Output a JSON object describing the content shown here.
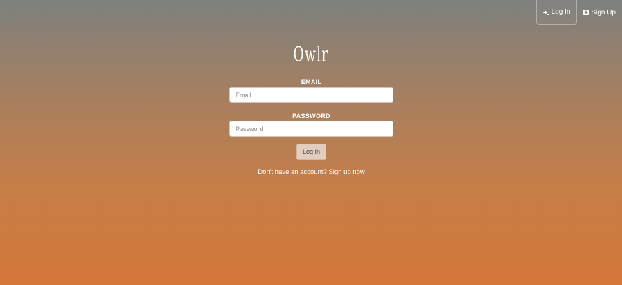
{
  "nav": {
    "login_label": "Log In",
    "signup_label": "Sign Up"
  },
  "logo": "Owlr",
  "form": {
    "email_label": "EMAIL",
    "email_placeholder": "Email",
    "password_label": "PASSWORD",
    "password_placeholder": "Password",
    "submit_label": "Log In",
    "signup_prompt": "Don't have an account?",
    "signup_link": "Sign up now"
  },
  "colors": {
    "gradient_top": "#7d817e",
    "gradient_bottom": "#d5783a",
    "button_bg": "#e2cdbe"
  },
  "icons": {
    "login": "sign-in-icon",
    "signup": "plus-square-icon"
  }
}
